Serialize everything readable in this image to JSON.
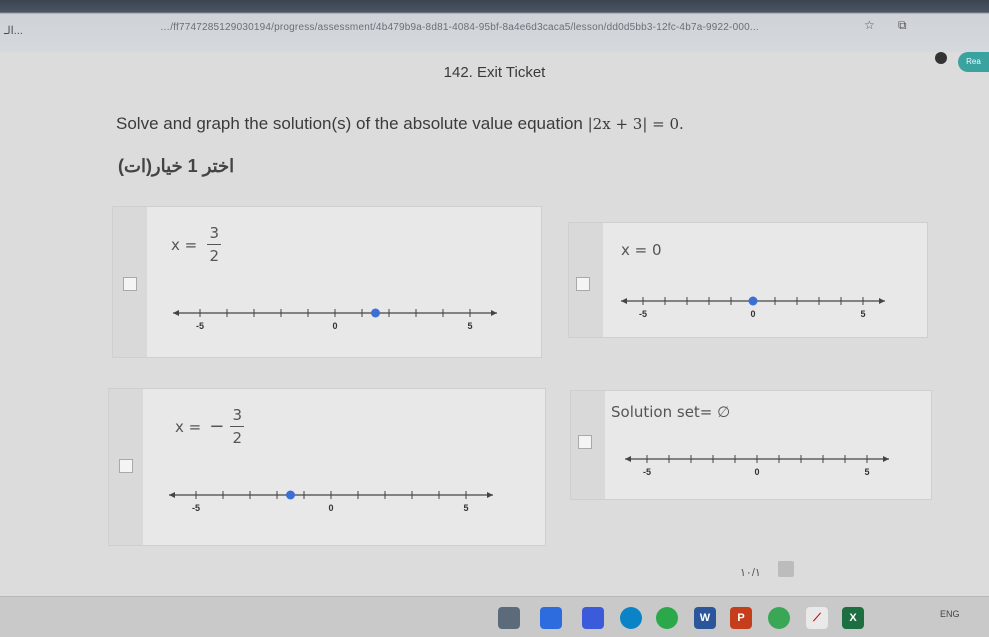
{
  "browser": {
    "back_label": "الـ...",
    "url": "…/ff7747285129030194/progress/assessment/4b479b9a-8d81-4084-95bf-8a4e6d3caca5/lesson/dd0d5bb3-12fc-4b7a-9922-000...",
    "ext_label": "Rea"
  },
  "page": {
    "title": "142. Exit Ticket"
  },
  "question": {
    "text": "Solve and graph the solution(s) of the absolute value equation",
    "equation": "|2x + 3| = 0.",
    "instruction_ar": "اختر 1 خيار(ات)"
  },
  "options": [
    {
      "prefix": "x =",
      "sign": "",
      "num": "3",
      "den": "2",
      "plain": "",
      "point": 1.5
    },
    {
      "prefix": "",
      "sign": "",
      "num": "",
      "den": "",
      "plain": "x = 0",
      "point": 0
    },
    {
      "prefix": "x =",
      "sign": "−",
      "num": "3",
      "den": "2",
      "plain": "",
      "point": -1.5
    },
    {
      "prefix": "",
      "sign": "",
      "num": "",
      "den": "",
      "plain": "Solution set= ∅",
      "point": null
    }
  ],
  "numberline": {
    "min": -6,
    "max": 6,
    "labels": [
      "-5",
      "0",
      "5"
    ],
    "label_values": [
      -5,
      0,
      5
    ],
    "point_color": "#3b6fd6"
  },
  "pagination": {
    "text": "١٠/١"
  },
  "taskbar": {
    "lang": "ENG"
  }
}
